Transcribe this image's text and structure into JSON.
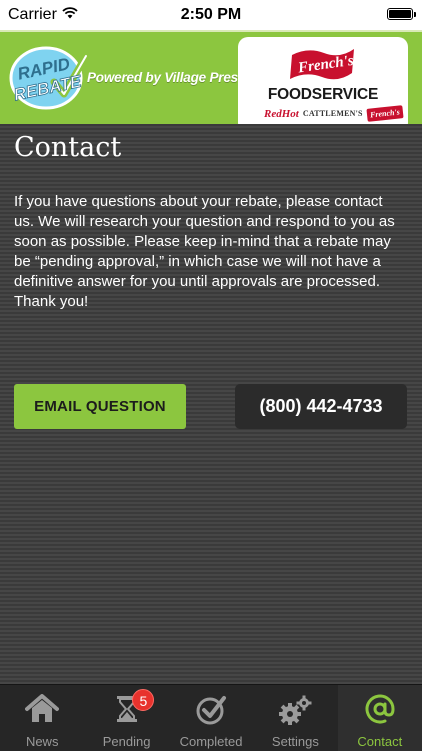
{
  "status_bar": {
    "carrier": "Carrier",
    "time": "2:50 PM",
    "wifi_icon": "wifi-icon",
    "battery_icon": "battery-icon"
  },
  "header": {
    "logo_text_line1": "RAPID",
    "logo_text_line2": "REBATE",
    "powered_by": "Powered by Village Press",
    "brand_card": {
      "frenchs": "French's",
      "foodservice": "FOODSERVICE",
      "redhot": "RedHot",
      "cattlemens": "CATTLEMEN'S",
      "frenchs_small": "French's"
    },
    "colors": {
      "accent_green": "#8cc63f",
      "brand_red": "#c8102e"
    }
  },
  "main": {
    "title": "Contact",
    "body": "If you have questions about your rebate, please contact us. We will research your question and respond to you as soon as possible. Please keep in-mind that a rebate may be “pending approval,” in which case we will not have a definitive answer for you until approvals are processed. Thank you!",
    "email_button_label": "EMAIL QUESTION",
    "phone_button_label": "(800) 442-4733"
  },
  "tab_bar": {
    "tabs": [
      {
        "label": "News",
        "icon": "house-icon",
        "active": false
      },
      {
        "label": "Pending",
        "icon": "hourglass-icon",
        "active": false,
        "badge": "5"
      },
      {
        "label": "Completed",
        "icon": "check-circle-icon",
        "active": false
      },
      {
        "label": "Settings",
        "icon": "gears-icon",
        "active": false
      },
      {
        "label": "Contact",
        "icon": "at-sign-icon",
        "active": true
      }
    ]
  }
}
